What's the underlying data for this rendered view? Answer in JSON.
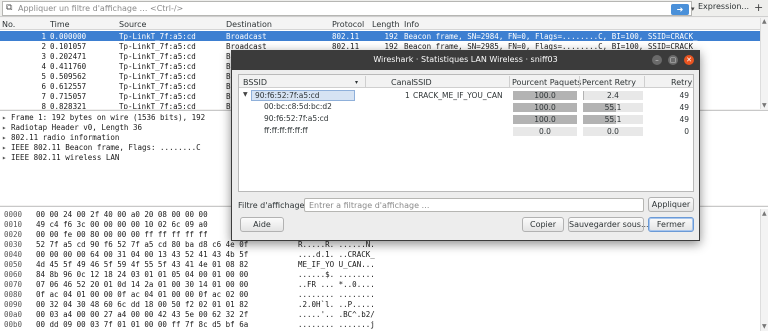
{
  "filterbar": {
    "placeholder": "Appliquer un filtre d'affichage … <Ctrl-/>",
    "expression_label": "Expression...",
    "plus_label": "+"
  },
  "packet_list": {
    "headers": [
      "No.",
      "Time",
      "Source",
      "Destination",
      "Protocol",
      "Length",
      "Info"
    ],
    "rows": [
      {
        "no": "1",
        "time": "0.000000",
        "src": "Tp-LinkT_7f:a5:cd",
        "dst": "Broadcast",
        "proto": "802.11",
        "len": "192",
        "info": "Beacon frame, SN=2984, FN=0, Flags=........C, BI=100, SSID=CRACK_",
        "selected": true
      },
      {
        "no": "2",
        "time": "0.101057",
        "src": "Tp-LinkT_7f:a5:cd",
        "dst": "Broadcast",
        "proto": "802.11",
        "len": "192",
        "info": "Beacon frame, SN=2985, FN=0, Flags=........C, BI=100, SSID=CRACK_",
        "selected": false
      },
      {
        "no": "3",
        "time": "0.202471",
        "src": "Tp-LinkT_7f:a5:cd",
        "dst": "B",
        "proto": "",
        "len": "",
        "info": "",
        "selected": false
      },
      {
        "no": "4",
        "time": "0.411760",
        "src": "Tp-LinkT_7f:a5:cd",
        "dst": "B",
        "proto": "",
        "len": "",
        "info": "",
        "selected": false
      },
      {
        "no": "5",
        "time": "0.509562",
        "src": "Tp-LinkT_7f:a5:cd",
        "dst": "B",
        "proto": "",
        "len": "",
        "info": "",
        "selected": false
      },
      {
        "no": "6",
        "time": "0.612557",
        "src": "Tp-LinkT_7f:a5:cd",
        "dst": "B",
        "proto": "",
        "len": "",
        "info": "",
        "selected": false
      },
      {
        "no": "7",
        "time": "0.715057",
        "src": "Tp-LinkT_7f:a5:cd",
        "dst": "B",
        "proto": "",
        "len": "",
        "info": "",
        "selected": false
      },
      {
        "no": "8",
        "time": "0.828321",
        "src": "Tp-LinkT_7f:a5:cd",
        "dst": "B",
        "proto": "",
        "len": "",
        "info": "",
        "selected": false
      }
    ]
  },
  "details": [
    {
      "tw": "▸",
      "text": "Frame 1: 192 bytes on wire (1536 bits), 192"
    },
    {
      "tw": "▸",
      "text": "Radiotap Header v0, Length 36"
    },
    {
      "tw": "▸",
      "text": "802.11 radio information"
    },
    {
      "tw": "▸",
      "text": "IEEE 802.11 Beacon frame, Flags: ........C"
    },
    {
      "tw": "▸",
      "text": "IEEE 802.11 wireless LAN"
    }
  ],
  "hex": [
    {
      "off": "0000",
      "hex": "00 00 24 00 2f 40 00 a0  20 08 00 00 00",
      "ascii": ""
    },
    {
      "off": "0010",
      "hex": "49 c4 f6 3c 00 00 00 00  10 02 6c 09 a0",
      "ascii": ""
    },
    {
      "off": "0020",
      "hex": "00 00 fe 00 80 00 00 00  ff ff ff ff ff",
      "ascii": ""
    },
    {
      "off": "0030",
      "hex": "52 7f a5 cd 90 f6 52 7f  a5 cd 80 ba d8 c6 4e 0f",
      "ascii": "R.....R. ......N."
    },
    {
      "off": "0040",
      "hex": "00 00 00 00 64 00 31 04  00 13 43 52 41 43 4b 5f",
      "ascii": "....d.1. ..CRACK_"
    },
    {
      "off": "0050",
      "hex": "4d 45 5f 49 46 5f 59 4f  55 5f 43 41 4e 01 08 82",
      "ascii": "ME_IF_YO U_CAN..."
    },
    {
      "off": "0060",
      "hex": "84 8b 96 0c 12 18 24 03  01 01 05 04 00 01 00 00",
      "ascii": "......$. ........"
    },
    {
      "off": "0070",
      "hex": "07 06 46 52 20 01 0d 14  2a 01 00 30 14 01 00 00",
      "ascii": "..FR ... *..0...."
    },
    {
      "off": "0080",
      "hex": "0f ac 04 01 00 00 0f ac  04 01 00 00 0f ac 02 00",
      "ascii": "........ ........"
    },
    {
      "off": "0090",
      "hex": "00 32 04 30 48 60 6c dd  18 00 50 f2 02 01 01 82",
      "ascii": ".2.0H`l. ..P....."
    },
    {
      "off": "00a0",
      "hex": "00 03 a4 00 00 27 a4 00  00 42 43 5e 00 62 32 2f",
      "ascii": ".....'.. .BC^.b2/"
    },
    {
      "off": "00b0",
      "hex": "00 dd 09 00 03 7f 01 01  00 00 ff 7f 8c d5 bf 6a",
      "ascii": "........ .......j"
    }
  ],
  "dialog": {
    "title": "Wireshark · Statistiques LAN Wireless · sniff03",
    "headers": {
      "bssid": "BSSID",
      "channel": "Canal",
      "ssid": "SSID",
      "pct_packets": "Pourcent Paquets",
      "pct_retry": "Percent Retry",
      "retry": "Retry"
    },
    "rows": [
      {
        "bssid": "90:f6:52:7f:a5:cd",
        "channel": "1",
        "ssid": "CRACK_ME_IF_YOU_CAN",
        "pct_packets": "100.0",
        "pct_retry": "2.4",
        "retry": "49",
        "level": "parent",
        "packets_fill": 1.0,
        "retry_fill": 0.024
      },
      {
        "bssid": "00:bc:c8:5d:bc:d2",
        "channel": "",
        "ssid": "",
        "pct_packets": "100.0",
        "pct_retry": "55.1",
        "retry": "49",
        "level": "child",
        "packets_fill": 1.0,
        "retry_fill": 0.551
      },
      {
        "bssid": "90:f6:52:7f:a5:cd",
        "channel": "",
        "ssid": "",
        "pct_packets": "100.0",
        "pct_retry": "55.1",
        "retry": "49",
        "level": "child",
        "packets_fill": 1.0,
        "retry_fill": 0.551
      },
      {
        "bssid": "ff:ff:ff:ff:ff:ff",
        "channel": "",
        "ssid": "",
        "pct_packets": "0.0",
        "pct_retry": "0.0",
        "retry": "0",
        "level": "child",
        "packets_fill": 0.0,
        "retry_fill": 0.0
      }
    ],
    "filter_label": "Filtre d'affichage :",
    "filter_placeholder": "Entrer a filtrage d'affichage …",
    "apply_label": "Appliquer",
    "help_label": "Aide",
    "copy_label": "Copier",
    "save_label": "Sauvegarder sous...",
    "close_label": "Fermer"
  }
}
